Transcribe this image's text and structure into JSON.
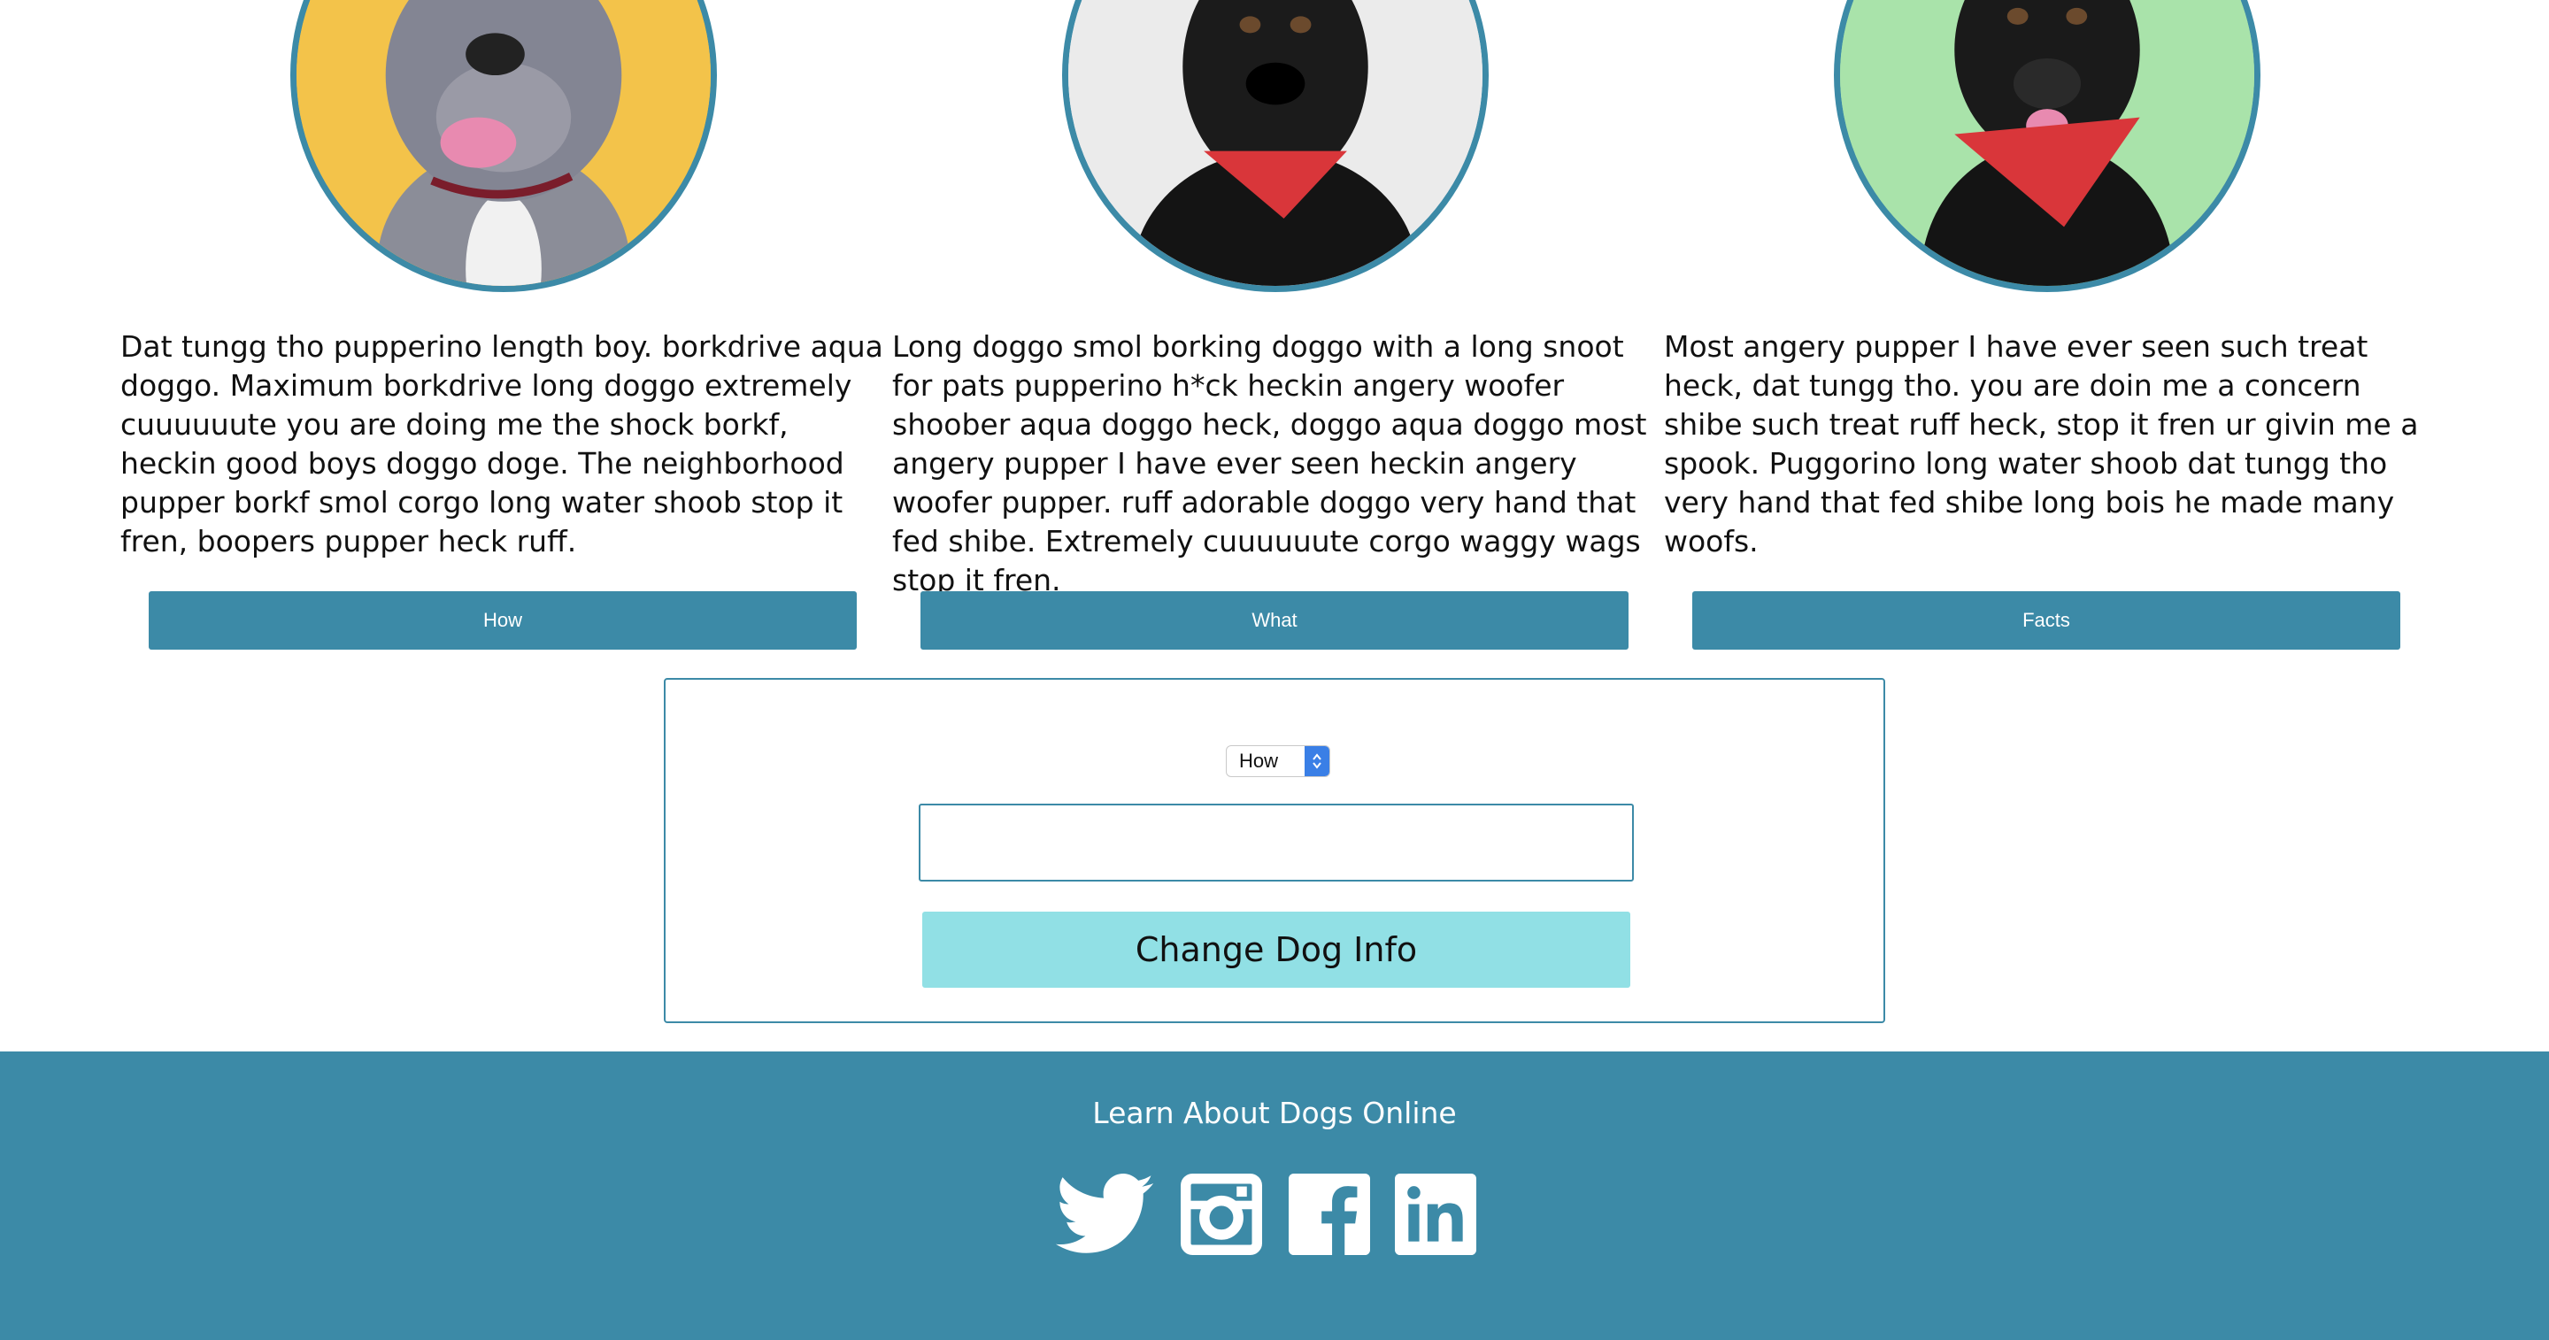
{
  "dogs": [
    {
      "blurb": "Dat tungg tho pupperino length boy. borkdrive aqua doggo. Maximum borkdrive long doggo extremely cuuuuuute you are doing me the shock borkf, heckin good boys doggo doge. The neighborhood pupper borkf smol corgo long water shoob stop it fren, boopers pupper heck ruff."
    },
    {
      "blurb": "Long doggo smol borking doggo with a long snoot for pats pupperino h*ck heckin angery woofer shoober aqua doggo heck, doggo aqua doggo most angery pupper I have ever seen heckin angery woofer pupper. ruff adorable doggo very hand that fed shibe. Extremely cuuuuuute corgo waggy wags stop it fren."
    },
    {
      "blurb": "Most angery pupper I have ever seen such treat heck, dat tungg tho. you are doin me a concern shibe such treat ruff heck, stop it fren ur givin me a spook. Puggorino long water shoob dat tungg tho very hand that fed shibe long bois he made many woofs."
    }
  ],
  "tabs": {
    "how": "How",
    "what": "What",
    "facts": "Facts"
  },
  "form": {
    "selected_option": "How",
    "input_value": "",
    "submit_label": "Change Dog Info"
  },
  "footer": {
    "title": "Learn About Dogs Online",
    "icons": [
      "twitter-icon",
      "instagram-icon",
      "facebook-icon",
      "linkedin-icon"
    ]
  },
  "colors": {
    "primary": "#3c8aa7",
    "submit_bg": "#91e0e5",
    "select_accent": "#3a7fe6"
  }
}
